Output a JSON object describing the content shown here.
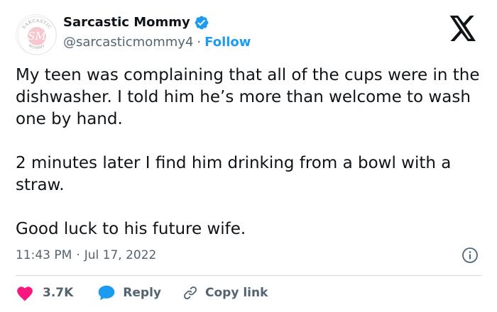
{
  "colors": {
    "text_primary": "#0f1419",
    "text_secondary": "#536471",
    "accent_blue": "#1d9bf0",
    "like_red": "#f91880",
    "divider": "#cfd9de"
  },
  "author": {
    "display_name": "Sarcastic Mommy",
    "handle": "@sarcasticmommy4",
    "separator": "·",
    "follow_label": "Follow",
    "verified": true,
    "avatar": {
      "monogram": "SM",
      "ring_text_top": "SARCASTIC",
      "ring_text_bottom": "MOMMY"
    }
  },
  "tweet": {
    "paragraphs": [
      "My teen was complaining that all of the cups were in the dishwasher. I told him he’s more than welcome to wash one by hand.",
      "2 minutes later I find him drinking from a bowl with a straw.",
      "Good luck to his future wife."
    ]
  },
  "meta": {
    "time": "11:43 PM",
    "separator": "·",
    "date": "Jul 17, 2022"
  },
  "actions": {
    "like_count": "3.7K",
    "reply_label": "Reply",
    "copy_link_label": "Copy link"
  },
  "icons": {
    "brand": "x-logo-icon",
    "verified": "verified-badge-icon",
    "info": "info-icon",
    "like": "heart-icon",
    "reply": "speech-bubble-icon",
    "copy": "link-icon"
  }
}
